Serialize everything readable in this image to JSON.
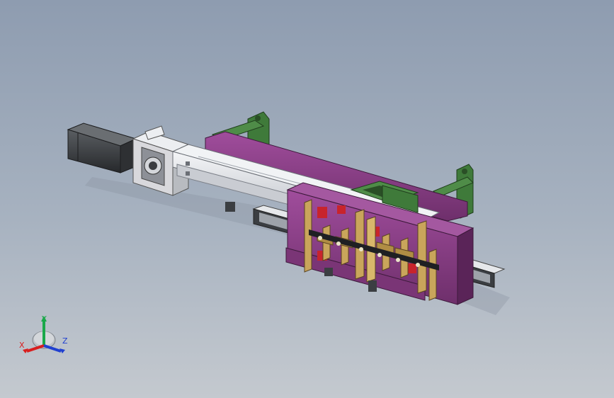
{
  "viewport": {
    "background_top": "#8e9cb0",
    "background_bottom": "#c4c9cf"
  },
  "model": {
    "motor_color": "#3c3f42",
    "bracket_color": "#d8d8dc",
    "rail_color": "#e3e6ea",
    "plate_color": "#8c3f8a",
    "support_color": "#3f7a3a",
    "gripper_color": "#c9a55b",
    "accent_color": "#c8242c"
  },
  "triad": {
    "x_label": "X",
    "y_label": "Y",
    "z_label": "Z",
    "x_color": "#d81e1e",
    "y_color": "#1aa84a",
    "z_color": "#2040d0"
  }
}
